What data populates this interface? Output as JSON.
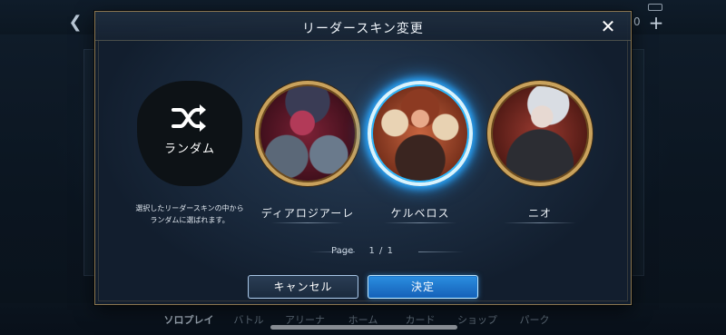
{
  "background": {
    "nav": [
      {
        "label": "ソロプレイ",
        "active": true
      },
      {
        "label": "バトル",
        "active": false
      },
      {
        "label": "アリーナ",
        "active": false
      },
      {
        "label": "ホーム",
        "active": false
      },
      {
        "label": "カード",
        "active": false
      },
      {
        "label": "ショップ",
        "active": false
      },
      {
        "label": "パーク",
        "active": false
      }
    ],
    "counter": "0",
    "colors": {
      "accent_gold": "#c9a25c",
      "selected_glow": "#2aa9ff"
    }
  },
  "modal": {
    "title": "リーダースキン変更",
    "close_icon": "close-icon",
    "skins": [
      {
        "type": "random",
        "label": "ランダム",
        "icon": "shuffle-icon",
        "description": [
          "選択したリーダースキンの中から",
          "ランダムに選ばれます。"
        ]
      },
      {
        "name": "ディアロジアーレ",
        "selected": false
      },
      {
        "name": "ケルベロス",
        "selected": true
      },
      {
        "name": "ニオ",
        "selected": false
      }
    ],
    "pager": {
      "label": "Page",
      "current": "1",
      "separator": "/",
      "total": "1"
    },
    "buttons": {
      "cancel": "キャンセル",
      "confirm": "決定"
    }
  }
}
